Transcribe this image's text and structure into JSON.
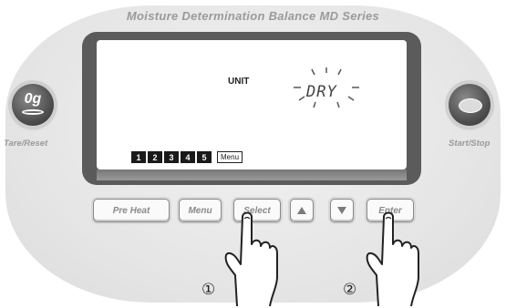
{
  "panel": {
    "title": "Moisture Determination Balance  MD Series",
    "tare_button": {
      "glyph": "0g",
      "label": "Tare/Reset"
    },
    "start_button": {
      "label": "Start/Stop"
    }
  },
  "display": {
    "unit_label": "UNIT",
    "segment_text": "DRY",
    "menu_numbers": [
      "1",
      "2",
      "3",
      "4",
      "5"
    ],
    "menu_tag": "Menu"
  },
  "keypad": {
    "preheat": "Pre Heat",
    "menu": "Menu",
    "select": "Select",
    "up_icon": "up-arrow-icon",
    "down_icon": "down-arrow-icon",
    "enter": "Enter"
  },
  "steps": {
    "first": "①",
    "second": "②"
  },
  "colors": {
    "bezel": "#5b5b5b",
    "label_gray": "#9a9a9a",
    "lcd_background": "#ffffff"
  }
}
